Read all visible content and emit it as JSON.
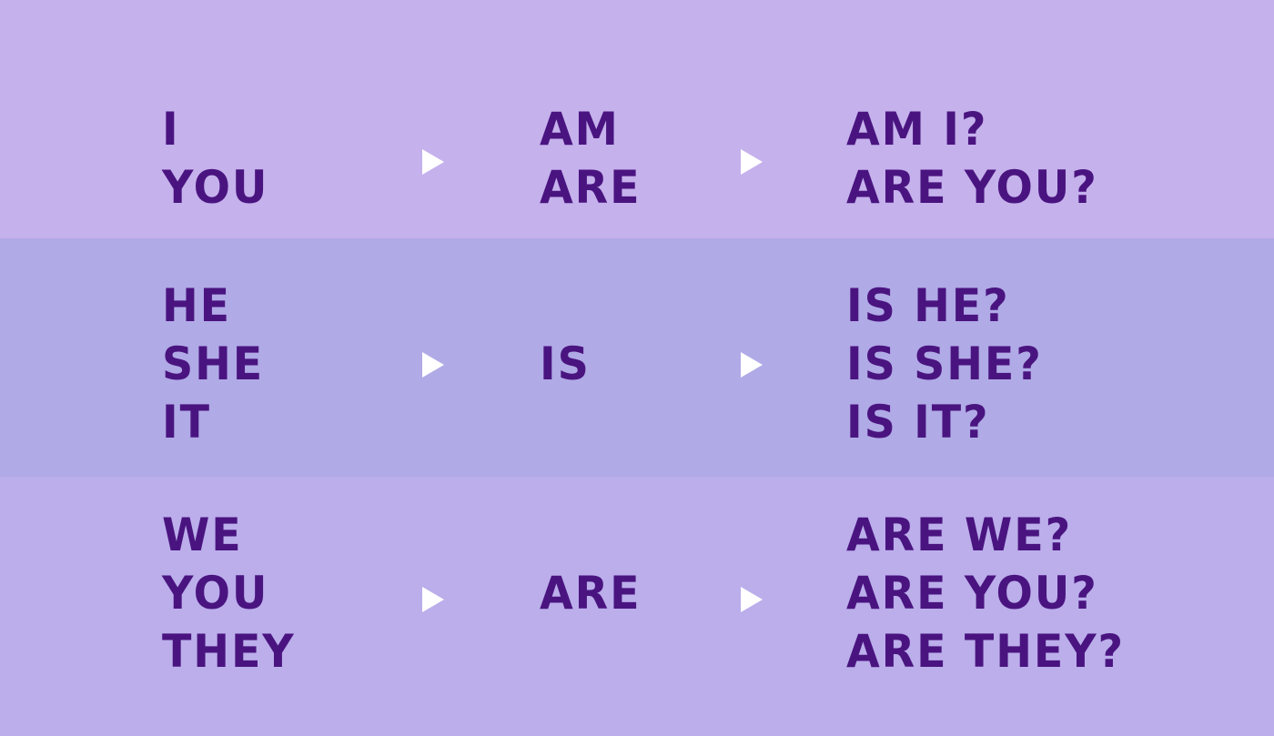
{
  "rows": [
    {
      "subjects": [
        "I",
        "YOU"
      ],
      "verb": [
        "AM",
        "ARE"
      ],
      "questions": [
        "AM I?",
        "ARE YOU?"
      ]
    },
    {
      "subjects": [
        "HE",
        "SHE",
        "IT"
      ],
      "verb": [
        "IS"
      ],
      "questions": [
        "IS HE?",
        "IS SHE?",
        "IS IT?"
      ]
    },
    {
      "subjects": [
        "WE",
        "YOU",
        "THEY"
      ],
      "verb": [
        "ARE"
      ],
      "questions": [
        "ARE WE?",
        "ARE YOU?",
        "ARE THEY?"
      ]
    }
  ],
  "colors": {
    "text": "#4a1480",
    "arrow": "#ffffff",
    "band_1": "#c5b1ec",
    "band_2": "#b0aae6",
    "band_3": "#bbaeeb"
  },
  "icons": {
    "arrow": "play-triangle-icon"
  }
}
